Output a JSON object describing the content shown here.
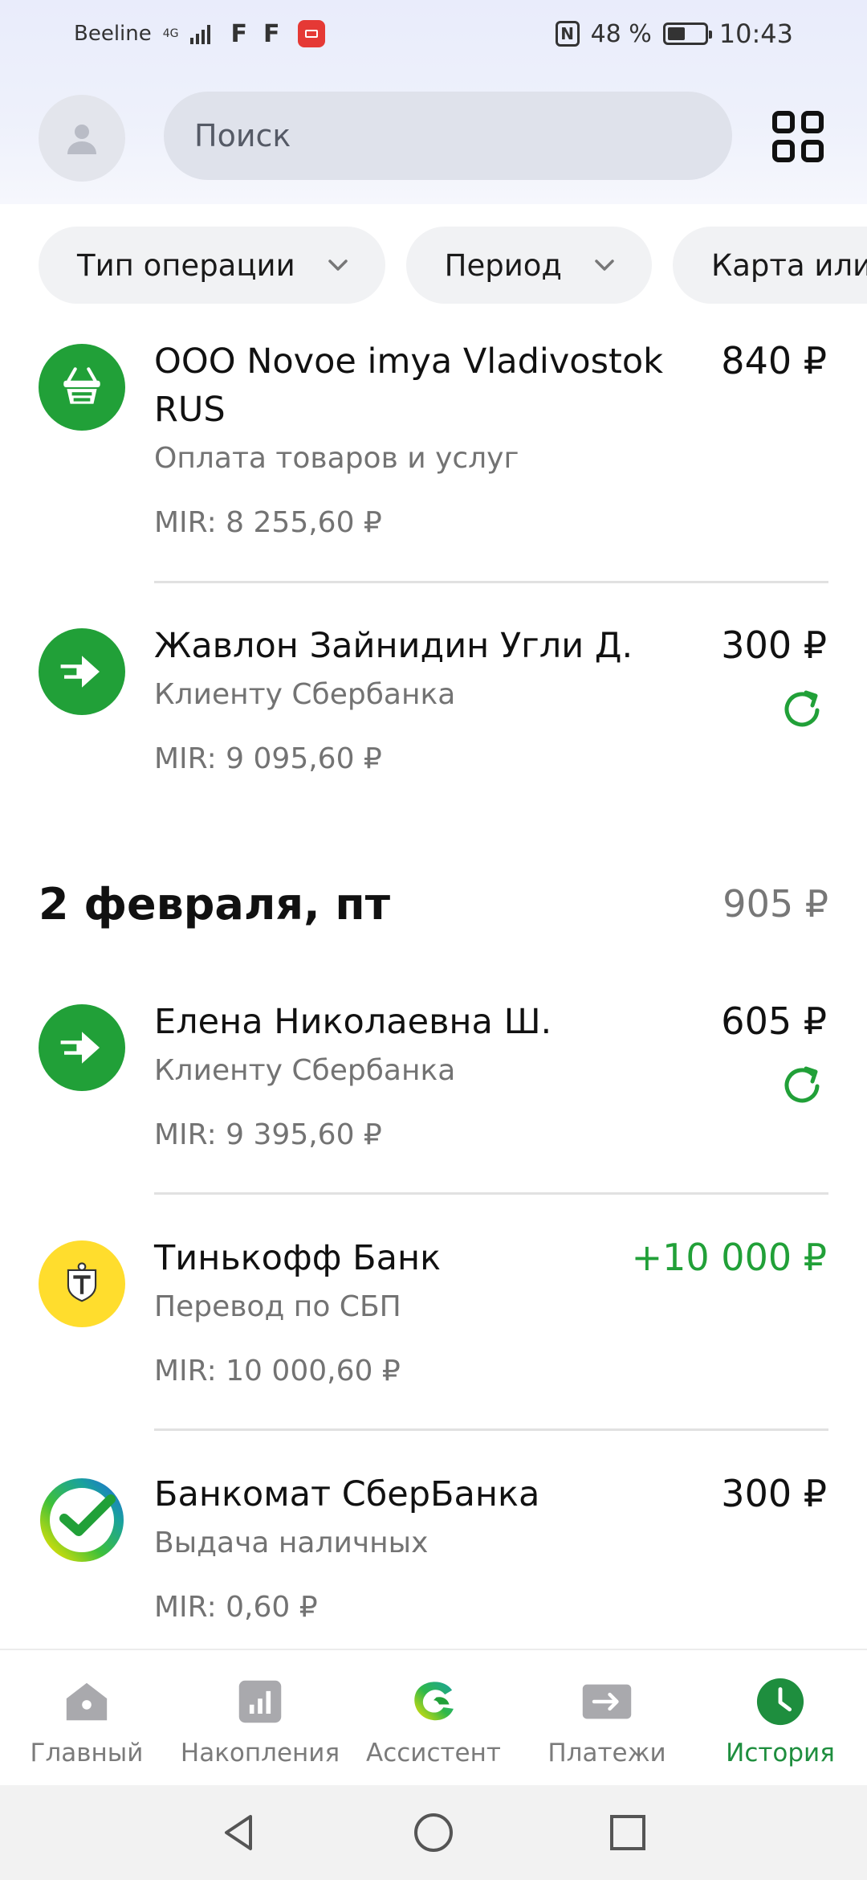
{
  "status_bar": {
    "carrier": "Beeline",
    "network": "4G",
    "f1": "F",
    "f2": "F",
    "battery": "48 %",
    "battery_level": 0.48,
    "time": "10:43"
  },
  "header": {
    "search_placeholder": "Поиск"
  },
  "filters": [
    {
      "label": "Тип операции"
    },
    {
      "label": "Период"
    },
    {
      "label": "Карта или счёт"
    }
  ],
  "colors": {
    "brand_green": "#21a038",
    "tinkoff_yellow": "#ffdd2d",
    "active_nav": "#1e8e3e"
  },
  "transactions": [
    {
      "name": "ООО Novoe imya Vladivostok RUS",
      "subtitle": "Оплата товаров и услуг",
      "card": "MIR: 8 255,60 ₽",
      "amount": "840 ₽",
      "icon": "basket-icon"
    },
    {
      "name": "Жавлон Зайнидин Угли Д.",
      "subtitle": "Клиенту Сбербанка",
      "card": "MIR: 9 095,60 ₽",
      "amount": "300 ₽",
      "icon": "transfer-arrow-icon",
      "repeat": true
    }
  ],
  "date_group": {
    "title": "2 февраля, пт",
    "total": "905 ₽"
  },
  "transactions_2": [
    {
      "name": "Елена Николаевна Ш.",
      "subtitle": "Клиенту Сбербанка",
      "card": "MIR: 9 395,60 ₽",
      "amount": "605 ₽",
      "icon": "transfer-arrow-icon",
      "repeat": true
    },
    {
      "name": "Тинькофф Банк",
      "subtitle": "Перевод по СБП",
      "card": "MIR: 10 000,60 ₽",
      "amount": "+10 000 ₽",
      "icon": "tinkoff-logo-icon",
      "income": true
    },
    {
      "name": "Банкомат СберБанка",
      "subtitle": "Выдача наличных",
      "card": "MIR: 0,60 ₽",
      "amount": "300 ₽",
      "icon": "sberbank-logo-icon"
    }
  ],
  "bottom_nav": [
    {
      "label": "Главный",
      "icon": "home-icon"
    },
    {
      "label": "Накопления",
      "icon": "savings-chart-icon"
    },
    {
      "label": "Ассистент",
      "icon": "assistant-icon"
    },
    {
      "label": "Платежи",
      "icon": "payments-arrow-icon"
    },
    {
      "label": "История",
      "icon": "history-clock-icon",
      "active": true
    }
  ]
}
